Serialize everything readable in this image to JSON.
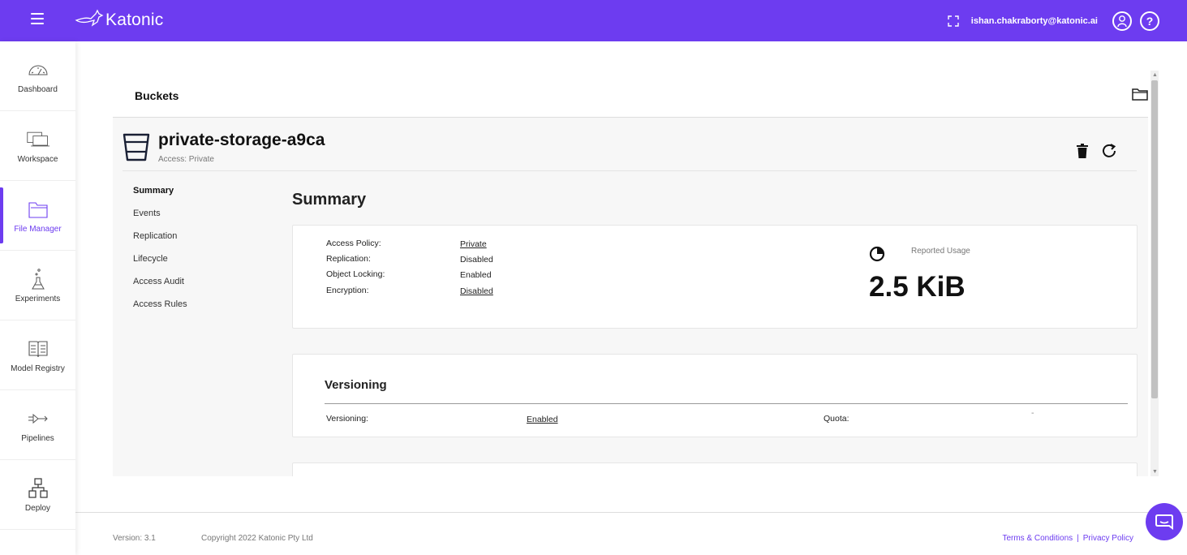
{
  "topbar": {
    "logo_text": "Katonic",
    "user_email": "ishan.chakraborty@katonic.ai",
    "help_glyph": "?",
    "icons": [
      "menu-icon",
      "expand-icon",
      "user-icon",
      "help-icon"
    ],
    "color": "#6d3cf0"
  },
  "sidebar": {
    "items": [
      {
        "label": "Dashboard",
        "icon": "speedometer-icon",
        "active": false
      },
      {
        "label": "Workspace",
        "icon": "laptop-icon",
        "active": false
      },
      {
        "label": "File Manager",
        "icon": "folder-icon",
        "active": true
      },
      {
        "label": "Experiments",
        "icon": "flask-icon",
        "active": false
      },
      {
        "label": "Model Registry",
        "icon": "book-icon",
        "active": false
      },
      {
        "label": "Pipelines",
        "icon": "pipeline-icon",
        "active": false
      },
      {
        "label": "Deploy",
        "icon": "deploy-icon",
        "active": false
      }
    ]
  },
  "page": {
    "title": "Buckets"
  },
  "bucket": {
    "name": "private-storage-a9ca",
    "access": "Access: Private"
  },
  "subnav": {
    "items": [
      "Summary",
      "Events",
      "Replication",
      "Lifecycle",
      "Access Audit",
      "Access Rules"
    ],
    "active": "Summary"
  },
  "summary": {
    "title": "Summary",
    "rows": [
      {
        "label": "Access Policy:",
        "value": "Private",
        "link": true
      },
      {
        "label": "Replication:",
        "value": "Disabled",
        "link": false
      },
      {
        "label": "Object Locking:",
        "value": "Enabled",
        "link": false
      },
      {
        "label": "Encryption:",
        "value": "Disabled",
        "link": true
      }
    ],
    "usage_label": "Reported Usage",
    "usage_value": "2.5 KiB"
  },
  "versioning": {
    "title": "Versioning",
    "label": "Versioning:",
    "value": "Enabled",
    "quota_label": "Quota:",
    "quota_value": "-"
  },
  "footer": {
    "version": "Version: 3.1",
    "copyright": "Copyright 2022 Katonic Pty Ltd",
    "terms": "Terms & Conditions",
    "separator": "|",
    "privacy": "Privacy Policy"
  }
}
